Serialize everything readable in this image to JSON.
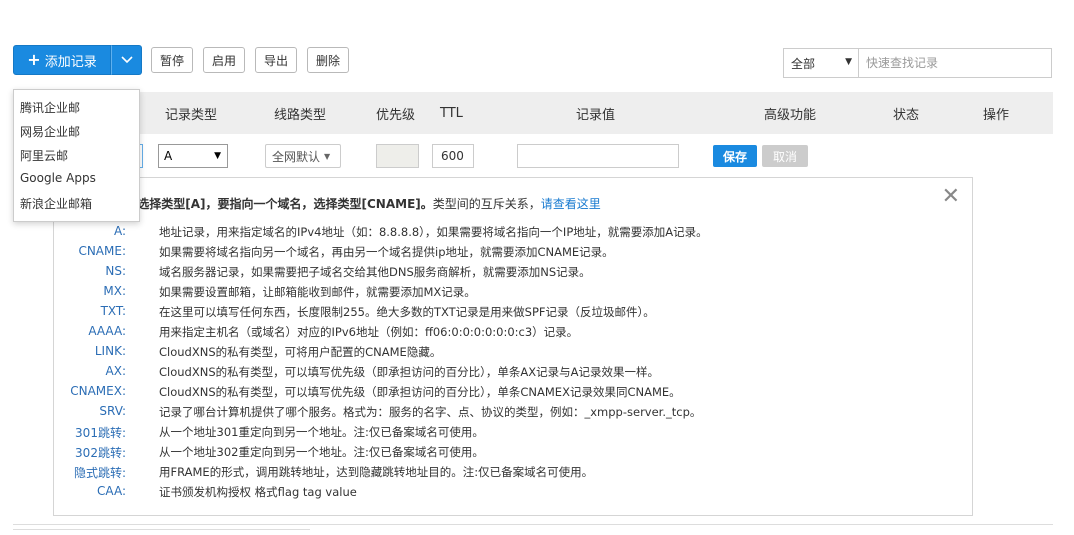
{
  "toolbar": {
    "add_label": "添加记录",
    "pause_label": "暂停",
    "enable_label": "启用",
    "export_label": "导出",
    "delete_label": "删除"
  },
  "filter": {
    "selected": "全部",
    "search_placeholder": "快速查找记录"
  },
  "columns": [
    "记录类型",
    "线路类型",
    "优先级",
    "TTL",
    "记录值",
    "高级功能",
    "状态",
    "操作"
  ],
  "edit_row": {
    "type_value": "A",
    "line_value": "全网默认",
    "ttl_value": "600",
    "save_label": "保存",
    "cancel_label": "取消"
  },
  "help": {
    "intro_bold": "目标IP地址，选择类型[A]，要指向一个域名，选择类型[CNAME]。",
    "intro_rest": "类型间的互斥关系，",
    "intro_link": "请查看这里",
    "rows": [
      {
        "k": "A:",
        "v": "地址记录，用来指定域名的IPv4地址（如：8.8.8.8），如果需要将域名指向一个IP地址，就需要添加A记录。"
      },
      {
        "k": "CNAME:",
        "v": "如果需要将域名指向另一个域名，再由另一个域名提供ip地址，就需要添加CNAME记录。"
      },
      {
        "k": "NS:",
        "v": "域名服务器记录，如果需要把子域名交给其他DNS服务商解析，就需要添加NS记录。"
      },
      {
        "k": "MX:",
        "v": "如果需要设置邮箱，让邮箱能收到邮件，就需要添加MX记录。"
      },
      {
        "k": "TXT:",
        "v": "在这里可以填写任何东西，长度限制255。绝大多数的TXT记录是用来做SPF记录（反垃圾邮件）。"
      },
      {
        "k": "AAAA:",
        "v": "用来指定主机名（或域名）对应的IPv6地址（例如：ff06:0:0:0:0:0:0:c3）记录。"
      },
      {
        "k": "LINK:",
        "v": "CloudXNS的私有类型，可将用户配置的CNAME隐藏。"
      },
      {
        "k": "AX:",
        "v": "CloudXNS的私有类型，可以填写优先级（即承担访问的百分比），单条AX记录与A记录效果一样。"
      },
      {
        "k": "CNAMEX:",
        "v": "CloudXNS的私有类型，可以填写优先级（即承担访问的百分比），单条CNAMEX记录效果同CNAME。"
      },
      {
        "k": "SRV:",
        "v": "记录了哪台计算机提供了哪个服务。格式为：服务的名字、点、协议的类型，例如：_xmpp-server._tcp。"
      },
      {
        "k": "301跳转:",
        "v": "从一个地址301重定向到另一个地址。注:仅已备案域名可使用。"
      },
      {
        "k": "302跳转:",
        "v": "从一个地址302重定向到另一个地址。注:仅已备案域名可使用。"
      },
      {
        "k": "隐式跳转:",
        "v": "用FRAME的形式，调用跳转地址，达到隐藏跳转地址目的。注:仅已备案域名可使用。"
      },
      {
        "k": "CAA:",
        "v": "证书颁发机构授权 格式flag tag value"
      }
    ]
  },
  "dropdown": {
    "items": [
      "腾讯企业邮",
      "网易企业邮",
      "阿里云邮",
      "Google Apps",
      "新浪企业邮箱"
    ]
  },
  "colors": {
    "primary": "#1a8ae0",
    "header_bg": "#eeeeee",
    "link": "#1a7bd0",
    "type_key": "#2b6db5"
  }
}
